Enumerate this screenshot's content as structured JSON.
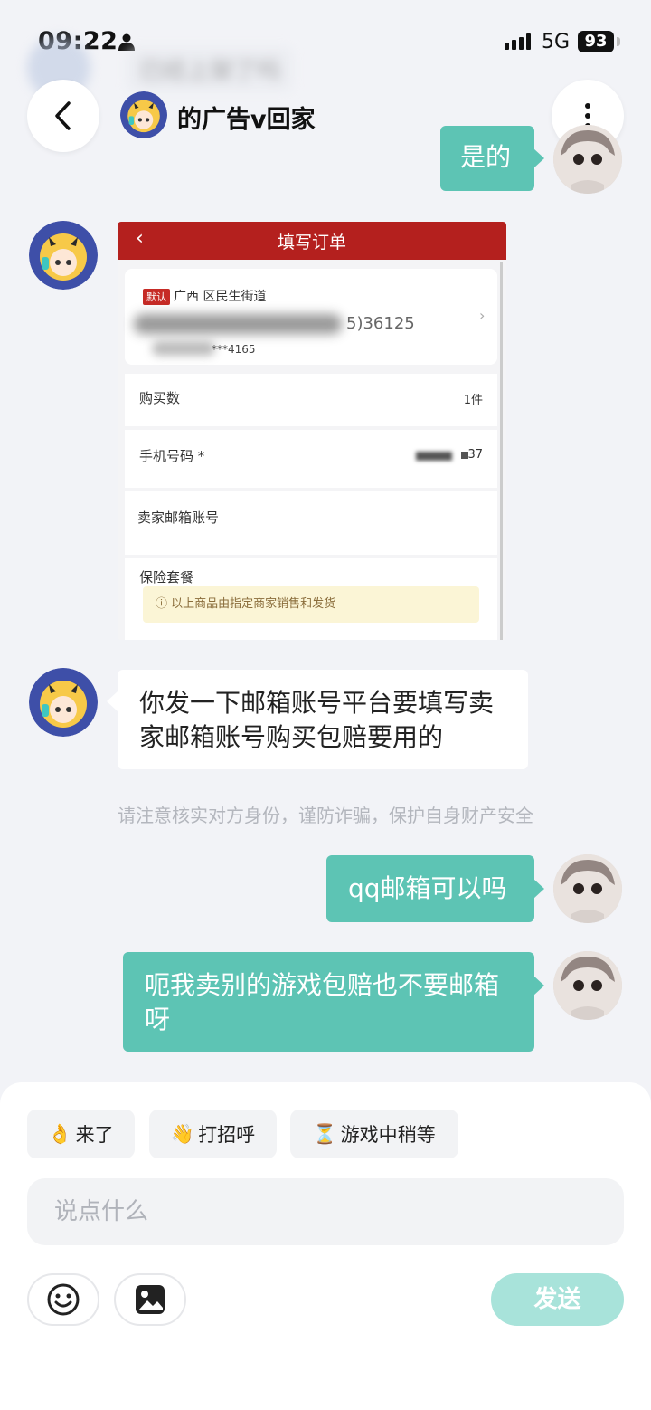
{
  "status_bar": {
    "time": "09:22",
    "network": "5G",
    "battery": "93"
  },
  "header": {
    "title": "的广告v回家"
  },
  "ghost_message": "已经上架了吗",
  "messages": [
    {
      "side": "out",
      "text": "是的"
    },
    {
      "side": "in",
      "type": "image",
      "image": {
        "title": "填写订单",
        "default_tag": "默认",
        "address": "广西        区民生街道",
        "phone_fragment": "5)36125",
        "masked_phone": "***4165",
        "rows": [
          {
            "label": "购买数",
            "value": "1件"
          },
          {
            "label": "手机号码 *",
            "value": "37"
          },
          {
            "label": "卖家邮箱账号",
            "value": ""
          },
          {
            "label": "保险套餐",
            "value": ""
          }
        ],
        "notice": "以上商品由指定商家销售和发货"
      }
    },
    {
      "side": "in",
      "text": "你发一下邮箱账号平台要填写卖家邮箱账号购买包赔要用的"
    },
    {
      "side": "out",
      "text": "qq邮箱可以吗"
    },
    {
      "side": "out",
      "text": "呃我卖别的游戏包赔也不要邮箱呀"
    }
  ],
  "safety_tip": "请注意核实对方身份，谨防诈骗，保护自身财产安全",
  "quick_replies": [
    {
      "emoji": "👌",
      "label": "来了"
    },
    {
      "emoji": "👋",
      "label": "打招呼"
    },
    {
      "emoji": "⏳",
      "label": "游戏中稍等"
    }
  ],
  "input": {
    "placeholder": "说点什么"
  },
  "send_label": "发送",
  "colors": {
    "accent": "#5dc4b4",
    "send_disabled": "#a8e3da",
    "order_red": "#b4201e"
  }
}
